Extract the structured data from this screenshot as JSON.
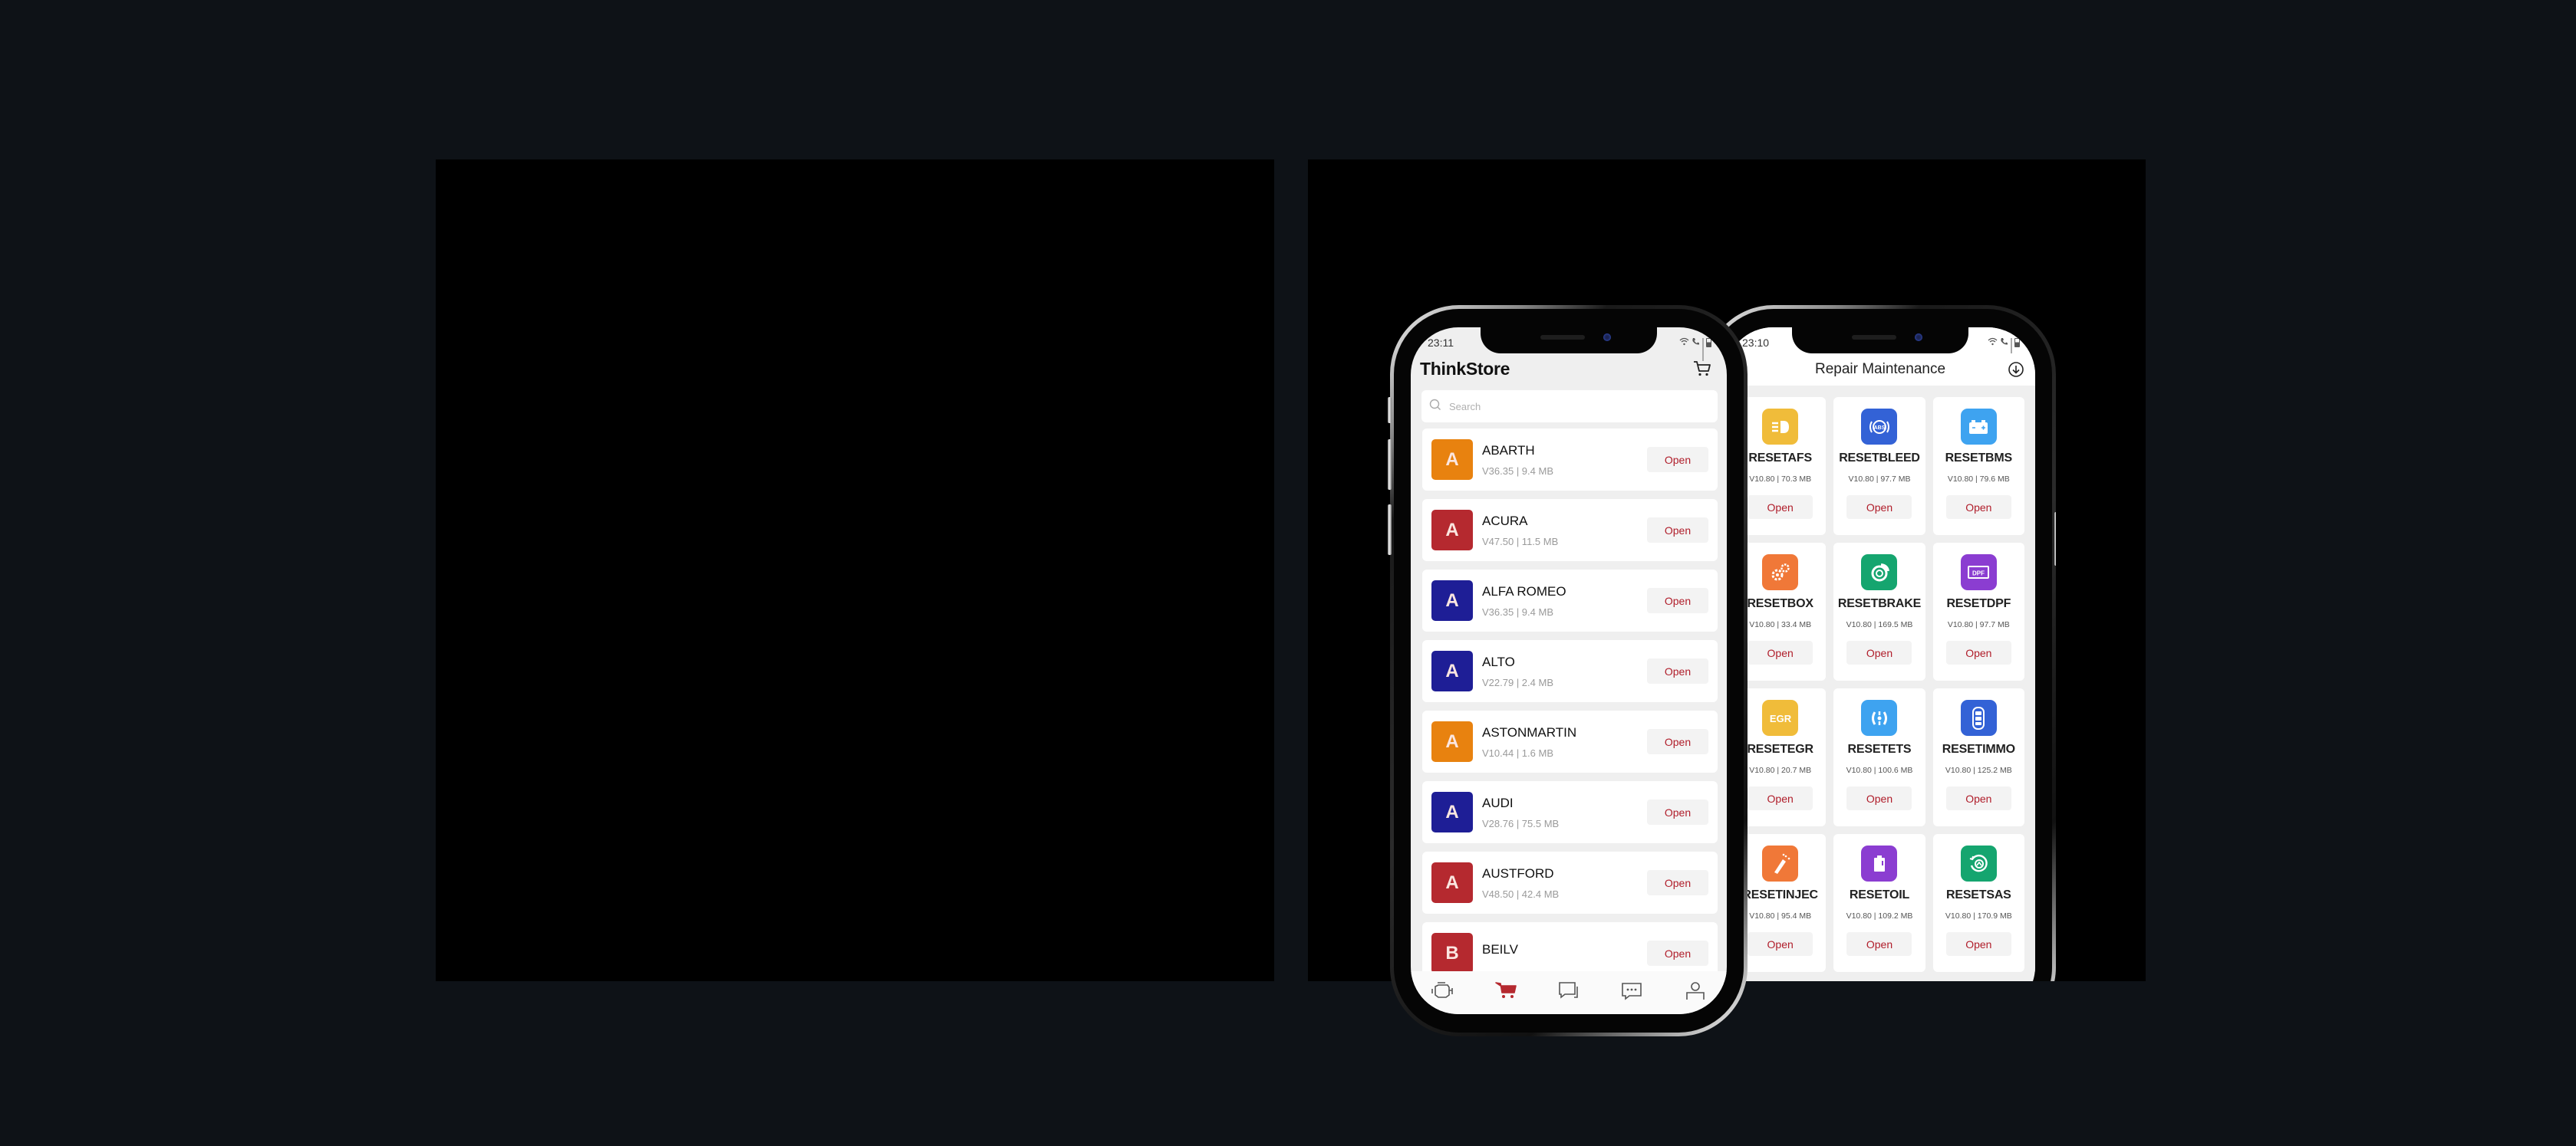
{
  "panels": {
    "left": "",
    "right": ""
  },
  "phone1": {
    "status_time": "23:11",
    "title": "ThinkStore",
    "search_placeholder": "Search",
    "brands": [
      {
        "letter": "A",
        "name": "ABARTH",
        "meta": "V36.35 | 9.4 MB",
        "color": "#e8820f",
        "open_label": "Open"
      },
      {
        "letter": "A",
        "name": "ACURA",
        "meta": "V47.50 | 11.5 MB",
        "color": "#b5292f",
        "open_label": "Open"
      },
      {
        "letter": "A",
        "name": "ALFA ROMEO",
        "meta": "V36.35 | 9.4 MB",
        "color": "#1e1e96",
        "open_label": "Open"
      },
      {
        "letter": "A",
        "name": "ALTO",
        "meta": "V22.79 | 2.4 MB",
        "color": "#1e1e96",
        "open_label": "Open"
      },
      {
        "letter": "A",
        "name": "ASTONMARTIN",
        "meta": "V10.44 | 1.6 MB",
        "color": "#e8820f",
        "open_label": "Open"
      },
      {
        "letter": "A",
        "name": "AUDI",
        "meta": "V28.76 | 75.5 MB",
        "color": "#1e1e96",
        "open_label": "Open"
      },
      {
        "letter": "A",
        "name": "AUSTFORD",
        "meta": "V48.50 | 42.4 MB",
        "color": "#b5292f",
        "open_label": "Open"
      },
      {
        "letter": "B",
        "name": "BEILV",
        "meta": "",
        "color": "#b5292f",
        "open_label": "Open"
      }
    ],
    "tabs": [
      {
        "name": "diagnose",
        "icon": "engine-icon",
        "active": false
      },
      {
        "name": "store",
        "icon": "cart-icon",
        "active": true
      },
      {
        "name": "reports",
        "icon": "chat-icon",
        "active": false
      },
      {
        "name": "messages",
        "icon": "message-icon",
        "active": false
      },
      {
        "name": "profile",
        "icon": "user-icon",
        "active": false
      }
    ],
    "accent_color": "#b01d2a"
  },
  "phone2": {
    "status_time": "23:10",
    "title": "Repair Maintenance",
    "modules": [
      {
        "name": "RESETAFS",
        "meta": "V10.80 | 70.3 MB",
        "color": "#f0bc3a",
        "icon": "headlight-icon",
        "open_label": "Open"
      },
      {
        "name": "RESETBLEED",
        "meta": "V10.80 | 97.7 MB",
        "color": "#3362d6",
        "icon": "abs-icon",
        "open_label": "Open"
      },
      {
        "name": "RESETBMS",
        "meta": "V10.80 | 79.6 MB",
        "color": "#3ea3f0",
        "icon": "battery-icon",
        "open_label": "Open"
      },
      {
        "name": "RESETBOX",
        "meta": "V10.80 | 33.4 MB",
        "color": "#f07838",
        "icon": "gears-icon",
        "open_label": "Open"
      },
      {
        "name": "RESETBRAKE",
        "meta": "V10.80 | 169.5 MB",
        "color": "#15a56f",
        "icon": "brake-disc-icon",
        "open_label": "Open"
      },
      {
        "name": "RESETDPF",
        "meta": "V10.80 | 97.7 MB",
        "color": "#8b3dd1",
        "icon": "dpf-icon",
        "open_label": "Open"
      },
      {
        "name": "RESETEGR",
        "meta": "V10.80 | 20.7 MB",
        "color": "#f0bc3a",
        "icon": "egr-icon",
        "open_label": "Open"
      },
      {
        "name": "RESETETS",
        "meta": "V10.80 | 100.6 MB",
        "color": "#3ea3f0",
        "icon": "ets-icon",
        "open_label": "Open"
      },
      {
        "name": "RESETIMMO",
        "meta": "V10.80 | 125.2 MB",
        "color": "#3362d6",
        "icon": "key-fob-icon",
        "open_label": "Open"
      },
      {
        "name": "RESETINJEC",
        "meta": "V10.80 | 95.4 MB",
        "color": "#f07838",
        "icon": "injector-icon",
        "open_label": "Open"
      },
      {
        "name": "RESETOIL",
        "meta": "V10.80 | 109.2 MB",
        "color": "#8b3dd1",
        "icon": "oil-can-icon",
        "open_label": "Open"
      },
      {
        "name": "RESETSAS",
        "meta": "V10.80 | 170.9 MB",
        "color": "#15a56f",
        "icon": "steering-icon",
        "open_label": "Open"
      }
    ],
    "egr_label": "EGR",
    "dpf_label": "DPF",
    "abs_label": "ABS",
    "nav": {
      "recents": "|||",
      "home": "○",
      "back": "‹"
    }
  }
}
